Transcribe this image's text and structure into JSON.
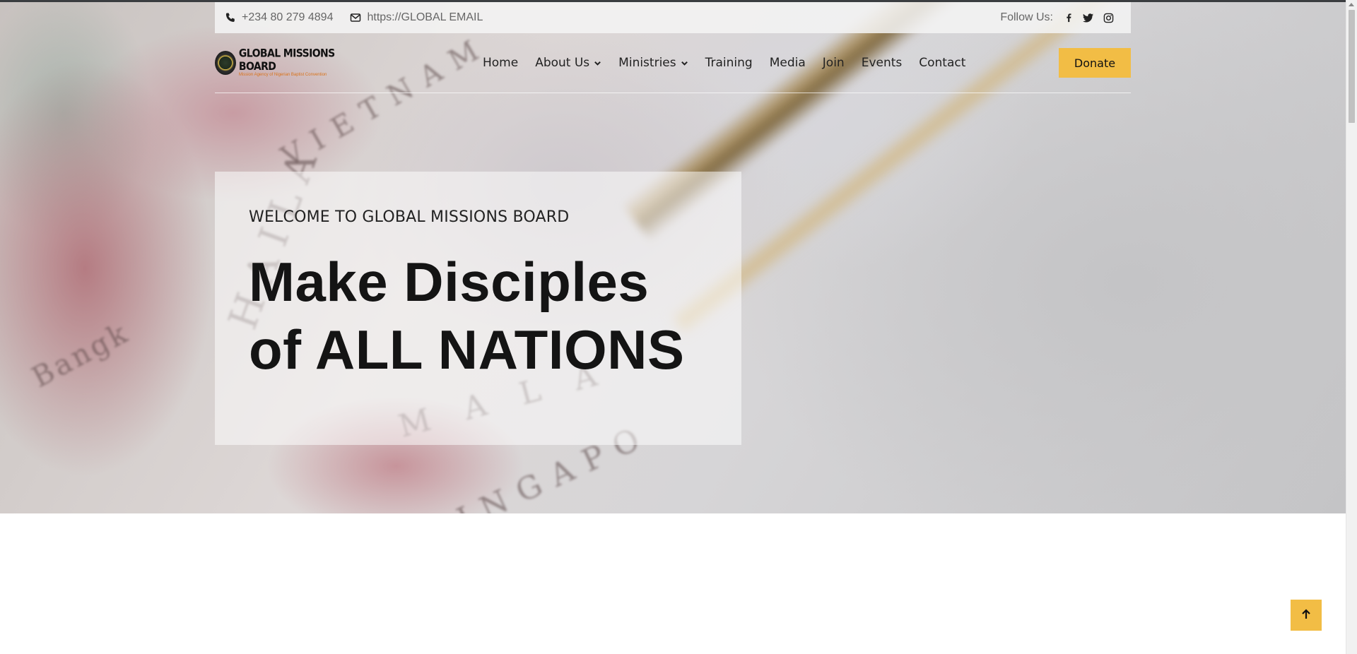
{
  "topbar": {
    "phone": "+234 80 279 4894",
    "email": "https://GLOBAL EMAIL",
    "follow_label": "Follow Us:",
    "socials": [
      "facebook-icon",
      "twitter-icon",
      "instagram-icon"
    ]
  },
  "header": {
    "logo_name": "GLOBAL MISSIONS BOARD",
    "logo_tagline": "Mission Agency of Nigerian Baptist Convention",
    "nav": {
      "home": "Home",
      "about": "About Us",
      "ministries": "Ministries",
      "training": "Training",
      "media": "Media",
      "join": "Join",
      "events": "Events",
      "contact": "Contact"
    },
    "donate_label": "Donate"
  },
  "hero": {
    "subtitle": "WELCOME TO GLOBAL MISSIONS BOARD",
    "headline_line1": "Make Disciples",
    "headline_line2": "of ALL NATIONS"
  },
  "colors": {
    "accent": "#f2bd45",
    "text_dark": "#141414"
  }
}
